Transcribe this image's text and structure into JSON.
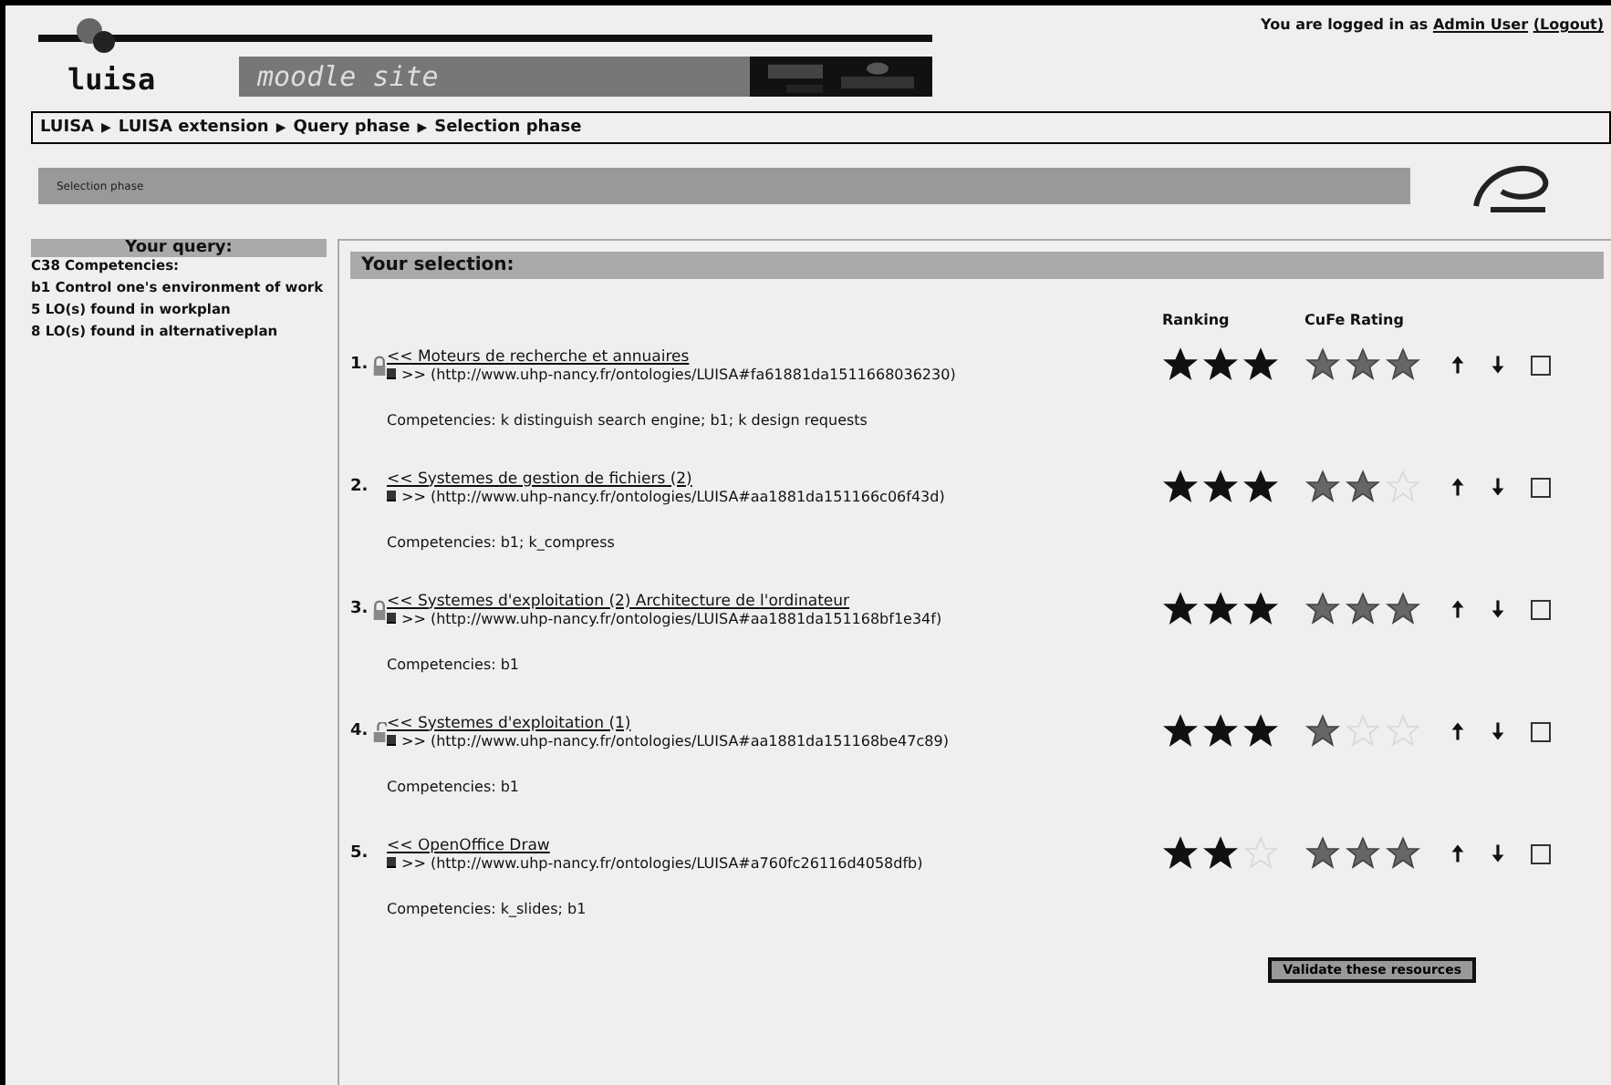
{
  "header": {
    "logo": "luisa",
    "site_name": "moodle site",
    "login_prefix": "You are logged in as ",
    "user": "Admin User",
    "logout": "(Logout)"
  },
  "breadcrumb": [
    {
      "label": "LUISA"
    },
    {
      "separator": "▶",
      "label": "LUISA extension"
    },
    {
      "separator": "▶",
      "label": "Query phase"
    },
    {
      "separator": "▶",
      "label": "Selection phase"
    }
  ],
  "phase_bar": "Selection phase",
  "sidebar": {
    "title": "Your query:",
    "lines": [
      "C38 Competencies:",
      "b1 Control one's environment of work",
      "5 LO(s) found in workplan",
      "8 LO(s) found in alternativeplan"
    ]
  },
  "selection": {
    "title": "Your selection:",
    "columns": [
      "Ranking",
      "CuFe Rating"
    ],
    "items": [
      {
        "number": "1.",
        "kind": "locked",
        "title": "<< Moteurs de recherche et annuaires",
        "url": ">> (http://www.uhp-nancy.fr/ontologies/LUISA#fa61881da1511668036230)",
        "competencies": "Competencies: k distinguish search engine; b1; k design requests",
        "ranking": {
          "stars": 3
        },
        "cufe": {
          "stars": 3
        },
        "checked": false
      },
      {
        "number": "2.",
        "kind": "plain",
        "title": "<< Systemes de gestion de fichiers (2)",
        "url": ">> (http://www.uhp-nancy.fr/ontologies/LUISA#aa1881da151166c06f43d)",
        "competencies": "Competencies: b1; k_compress",
        "ranking": {
          "stars": 3
        },
        "cufe": {
          "stars": 2
        },
        "checked": false
      },
      {
        "number": "3.",
        "kind": "locked",
        "title": "<< Systemes d'exploitation (2) Architecture de l'ordinateur",
        "url": ">> (http://www.uhp-nancy.fr/ontologies/LUISA#aa1881da151168bf1e34f)",
        "competencies": "Competencies: b1",
        "ranking": {
          "stars": 3
        },
        "cufe": {
          "stars": 3
        },
        "checked": false
      },
      {
        "number": "4.",
        "kind": "unlocked",
        "title": "<< Systemes d'exploitation (1)",
        "url": ">> (http://www.uhp-nancy.fr/ontologies/LUISA#aa1881da151168be47c89)",
        "competencies": "Competencies: b1",
        "ranking": {
          "stars": 3
        },
        "cufe": {
          "stars": 1
        },
        "checked": false
      },
      {
        "number": "5.",
        "kind": "plain",
        "title": "<< OpenOffice Draw",
        "url": ">> (http://www.uhp-nancy.fr/ontologies/LUISA#a760fc26116d4058dfb)",
        "competencies": "Competencies: k_slides; b1",
        "ranking": {
          "stars": 2
        },
        "cufe": {
          "stars": 3
        },
        "checked": false
      }
    ],
    "button": "Validate these resources"
  }
}
